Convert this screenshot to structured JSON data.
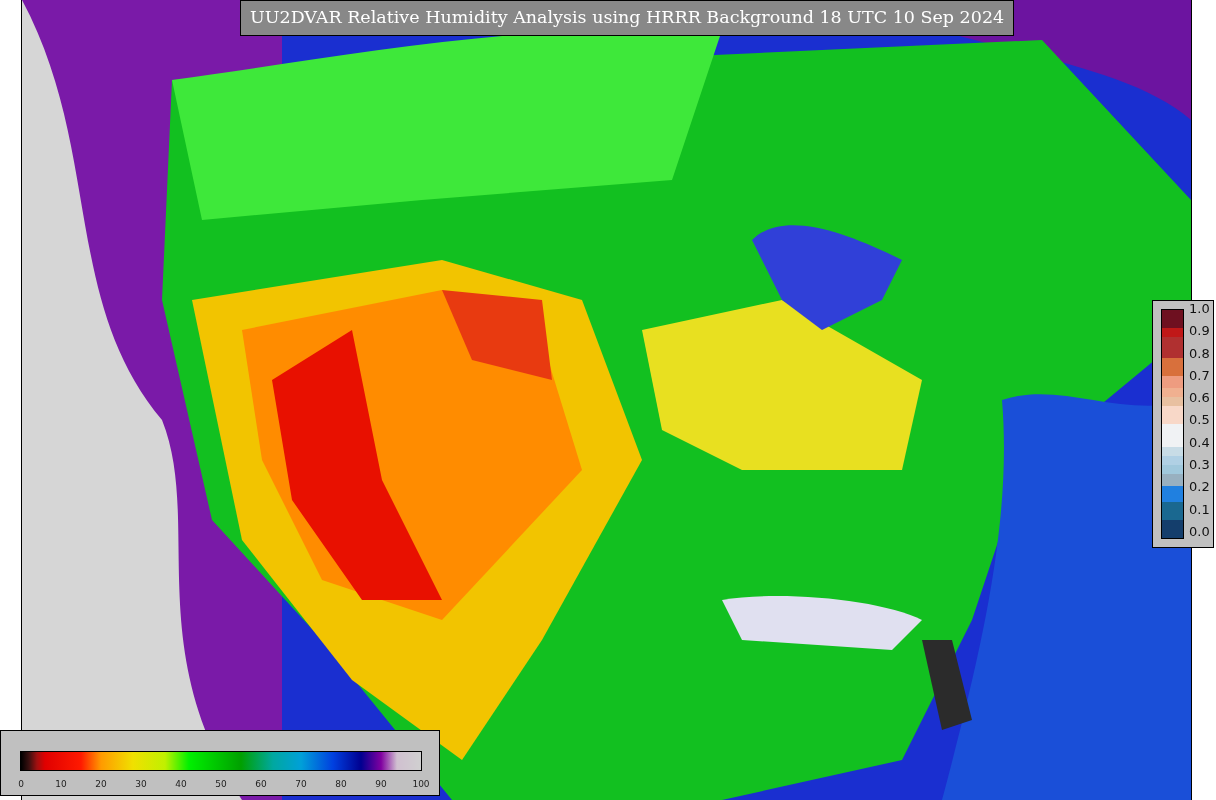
{
  "title": "UU2DVAR Relative Humidity Analysis using HRRR Background 18 UTC 10 Sep 2024",
  "humidity_colorbar": {
    "ticks": [
      "0",
      "10",
      "20",
      "30",
      "40",
      "50",
      "60",
      "70",
      "80",
      "90",
      "100"
    ]
  },
  "observation_colorbar": {
    "ticks": [
      "1.0",
      "0.9",
      "0.8",
      "0.7",
      "0.6",
      "0.5",
      "0.4",
      "0.3",
      "0.2",
      "0.1",
      "0.0"
    ]
  }
}
